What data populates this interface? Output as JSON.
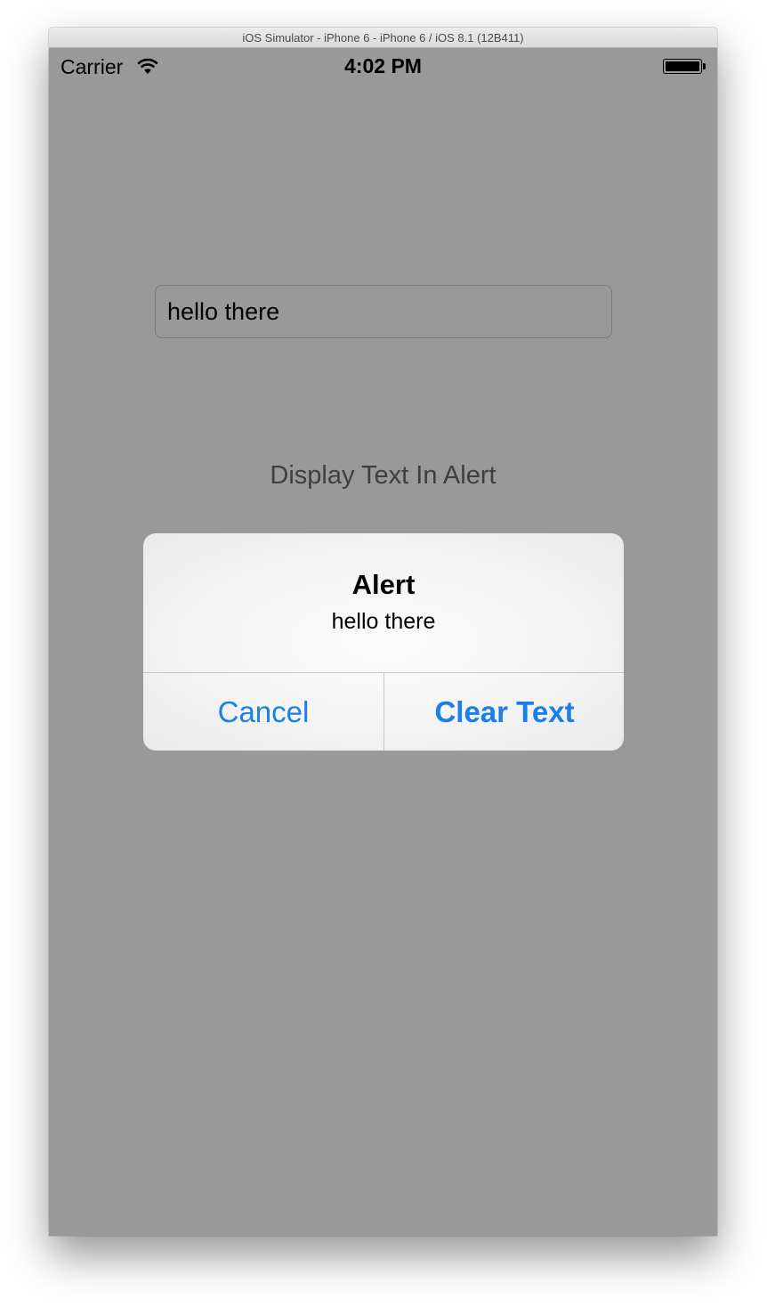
{
  "window": {
    "title": "iOS Simulator - iPhone 6 - iPhone 6 / iOS 8.1 (12B411)"
  },
  "status_bar": {
    "carrier": "Carrier",
    "time": "4:02 PM",
    "wifi_icon": "wifi-icon",
    "battery_icon": "battery-icon",
    "battery_level": 1.0
  },
  "main": {
    "text_field_value": "hello there",
    "display_button_label": "Display Text In Alert"
  },
  "alert": {
    "title": "Alert",
    "message": "hello there",
    "cancel_label": "Cancel",
    "primary_label": "Clear Text"
  },
  "colors": {
    "background_dim": "#999999",
    "accent": "#1a7fea"
  }
}
